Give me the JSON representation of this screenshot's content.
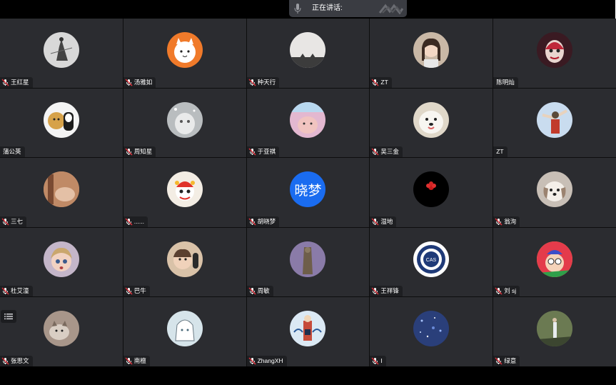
{
  "speaking": {
    "label": "正在讲话:"
  },
  "participants": [
    {
      "name": "王红星",
      "muted": true,
      "avatar": "warrior-figure",
      "bg": "#d8d8d8"
    },
    {
      "name": "汤雅如",
      "muted": true,
      "avatar": "cartoon-cat",
      "bg": "#f07a2a"
    },
    {
      "name": "种天行",
      "muted": true,
      "avatar": "cat-ears",
      "bg": "#e8e6e4"
    },
    {
      "name": "ZT",
      "muted": true,
      "avatar": "girl-photo",
      "bg": "#c9b8a6"
    },
    {
      "name": "陈明灿",
      "muted": false,
      "avatar": "clown-face",
      "bg": "#3a1a22"
    },
    {
      "name": "蒲公英",
      "muted": false,
      "avatar": "cartoon-pair",
      "bg": "#f4f4f4"
    },
    {
      "name": "周知星",
      "muted": true,
      "avatar": "white-creature",
      "bg": "#b9bdbf"
    },
    {
      "name": "于亚祺",
      "muted": true,
      "avatar": "cute-animal",
      "bg": "#e3b8d0"
    },
    {
      "name": "吴三金",
      "muted": true,
      "avatar": "white-dog",
      "bg": "#e0d8c9"
    },
    {
      "name": "ZT",
      "muted": false,
      "avatar": "anime-figure",
      "bg": "#c9dcef"
    },
    {
      "name": "三七",
      "muted": true,
      "avatar": "warm-photo",
      "bg": "#b57a5a"
    },
    {
      "name": "......",
      "muted": true,
      "avatar": "lion-dance",
      "bg": "#f3ede4"
    },
    {
      "name": "胡晓梦",
      "muted": true,
      "avatar": "text",
      "avatarText": "晓梦",
      "bg": "#1a6cf0"
    },
    {
      "name": "湿地",
      "muted": true,
      "avatar": "red-flower",
      "bg": "#000000"
    },
    {
      "name": "翁洵",
      "muted": true,
      "avatar": "puppy",
      "bg": "#c8bfb6"
    },
    {
      "name": "杜艾潼",
      "muted": true,
      "avatar": "3d-girl",
      "bg": "#c4b6c9"
    },
    {
      "name": "巴牛",
      "muted": true,
      "avatar": "baby",
      "bg": "#d9c2a8"
    },
    {
      "name": "周敏",
      "muted": true,
      "avatar": "statue",
      "bg": "#8a7ba8"
    },
    {
      "name": "王祥锋",
      "muted": true,
      "avatar": "emblem",
      "bg": "#ffffff"
    },
    {
      "name": "刘 sj",
      "muted": true,
      "avatar": "arale",
      "bg": "#f0c43a"
    },
    {
      "name": "张思文",
      "muted": true,
      "avatar": "cat-photo",
      "bg": "#a8968a"
    },
    {
      "name": "南檀",
      "muted": true,
      "avatar": "anime-sketch",
      "bg": "#d6e4ea"
    },
    {
      "name": "ZhangXH",
      "muted": true,
      "avatar": "sailor-doodle",
      "bg": "#dbe9f4"
    },
    {
      "name": "I",
      "muted": true,
      "avatar": "blue-stars",
      "bg": "#2a3f7a"
    },
    {
      "name": "绿意",
      "muted": true,
      "avatar": "forest-person",
      "bg": "#4f5c3e"
    }
  ],
  "icons": {
    "mic": "microphone-icon",
    "mute": "muted-mic-icon",
    "list": "list-icon"
  }
}
